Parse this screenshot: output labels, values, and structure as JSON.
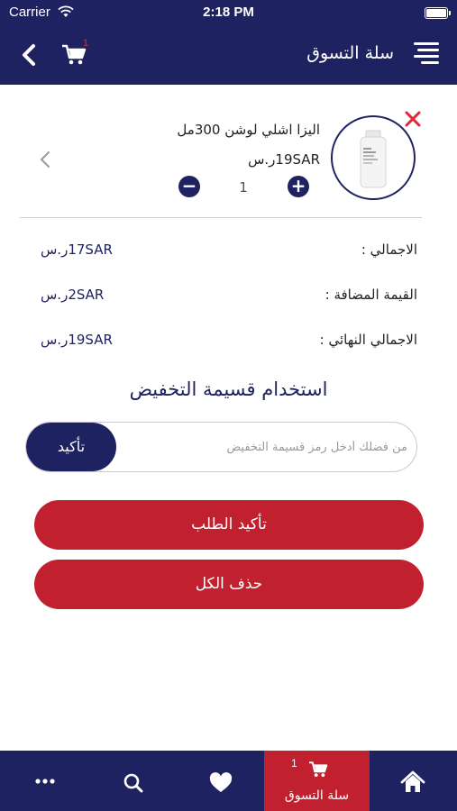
{
  "status_bar": {
    "carrier": "Carrier",
    "time": "2:18 PM"
  },
  "header": {
    "title": "سلة التسوق",
    "cart_count": "1"
  },
  "cart_item": {
    "name": "اليزا اشلي لوشن 300مل",
    "price": "19SARر.س",
    "quantity": "1"
  },
  "summary": {
    "total_label": "الاجمالي :",
    "total_value": "17SARر.س",
    "vat_label": "القيمة المضافة :",
    "vat_value": "2SARر.س",
    "final_label": "الاجمالي النهائي :",
    "final_value": "19SARر.س"
  },
  "discount": {
    "title": "استخدام قسيمة التخفيض",
    "placeholder": "من فضلك أدخل رمز قسيمة التخفيض",
    "apply_label": "تأكيد"
  },
  "actions": {
    "confirm_order": "تأكيد الطلب",
    "delete_all": "حذف الكل"
  },
  "tab_bar": {
    "cart_label": "سلة التسوق",
    "cart_count": "1"
  },
  "colors": {
    "primary": "#1f2260",
    "accent_red": "#c1212f"
  }
}
